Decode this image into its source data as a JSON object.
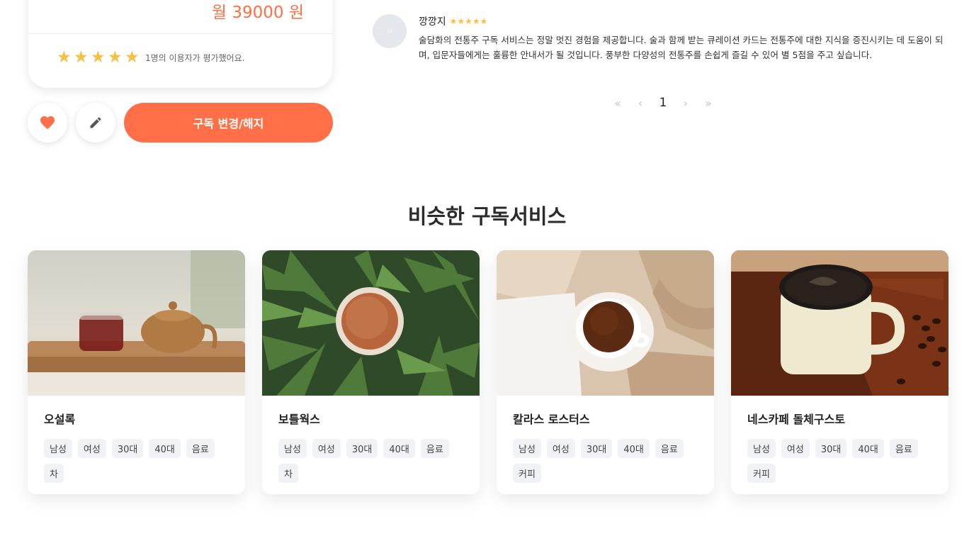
{
  "product": {
    "price": "월 39000 원",
    "rating_text": "1명의 이용자가 평가했어요.",
    "stars": 5,
    "subscribe_button": "구독 변경/해지",
    "colors": {
      "accent": "#ff7048",
      "star": "#f8c041"
    }
  },
  "review": {
    "avatar_text": "ᴊᴊ",
    "reviewer": "깡깡지",
    "stars": "★★★★★",
    "text": "술담화의 전통주 구독 서비스는 정말 멋진 경험을 제공합니다. 술과 함께 받는 큐레이션 카드는 전통주에 대한 지식을 증진시키는 데 도움이 되며, 입문자들에게는 훌륭한 안내서가 될 것입니다. 풍부한 다양성의 전통주를 손쉽게 즐길 수 있어 별 5점을 주고 싶습니다."
  },
  "pagination": {
    "first": "«",
    "prev": "‹",
    "current": "1",
    "next": "›",
    "last": "»"
  },
  "similar": {
    "title": "비슷한 구독서비스",
    "cards": [
      {
        "name": "오설록",
        "tags": [
          "남성",
          "여성",
          "30대",
          "40대",
          "음료",
          "차"
        ]
      },
      {
        "name": "보틀웍스",
        "tags": [
          "남성",
          "여성",
          "30대",
          "40대",
          "음료",
          "차"
        ]
      },
      {
        "name": "칼라스 로스터스",
        "tags": [
          "남성",
          "여성",
          "30대",
          "40대",
          "음료",
          "커피"
        ]
      },
      {
        "name": "네스카페 돌체구스토",
        "tags": [
          "남성",
          "여성",
          "30대",
          "40대",
          "음료",
          "커피"
        ]
      }
    ]
  }
}
